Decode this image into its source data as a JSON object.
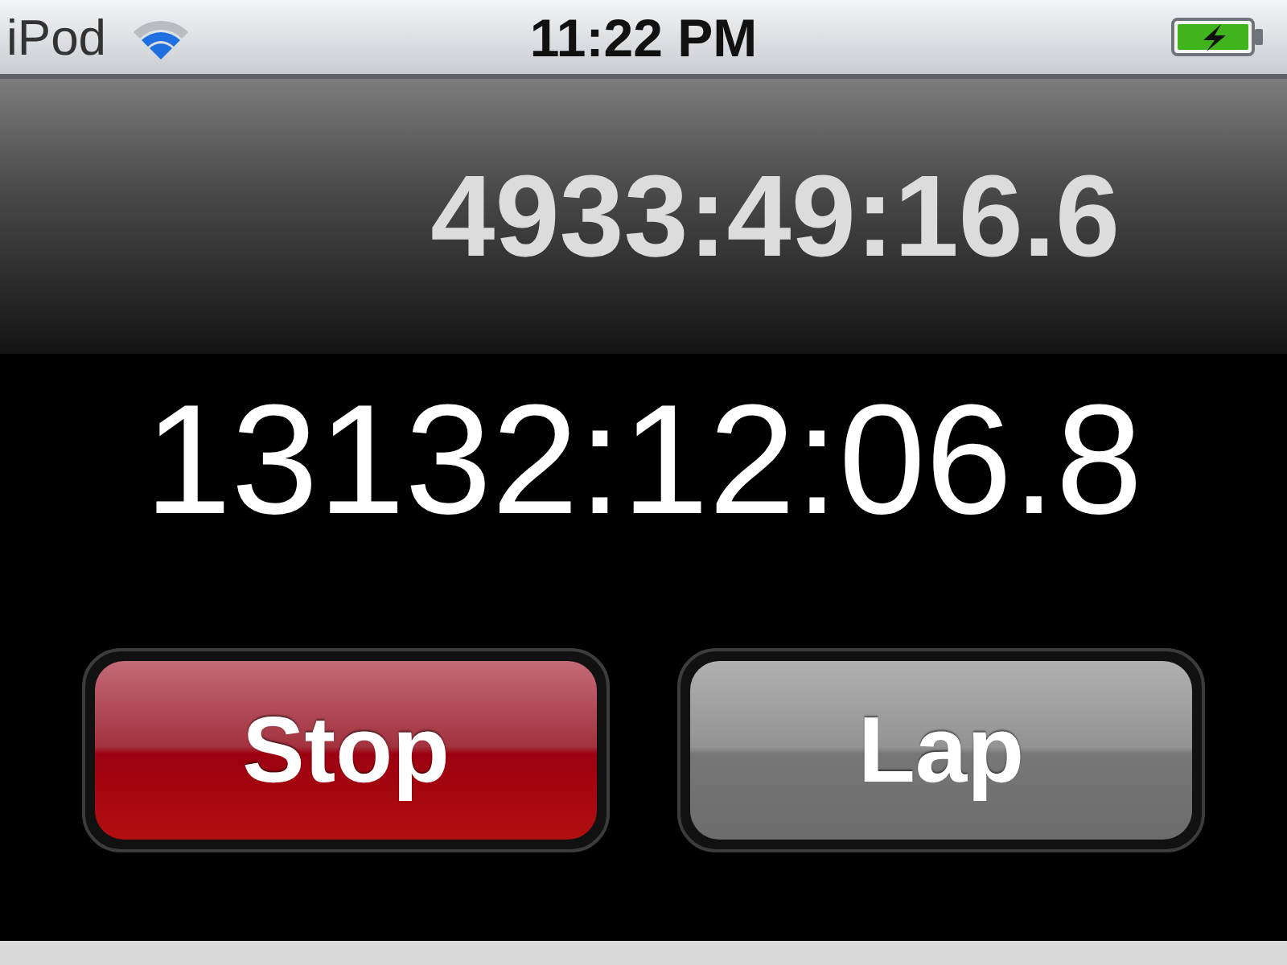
{
  "status_bar": {
    "carrier": "iPod",
    "time": "11:22 PM",
    "charging": true
  },
  "lap_time": "4933:49:16.6",
  "main_time": "13132:12:06.8",
  "buttons": [
    {
      "label": "Stop",
      "kind": "stop"
    },
    {
      "label": "Lap",
      "kind": "lap"
    }
  ]
}
